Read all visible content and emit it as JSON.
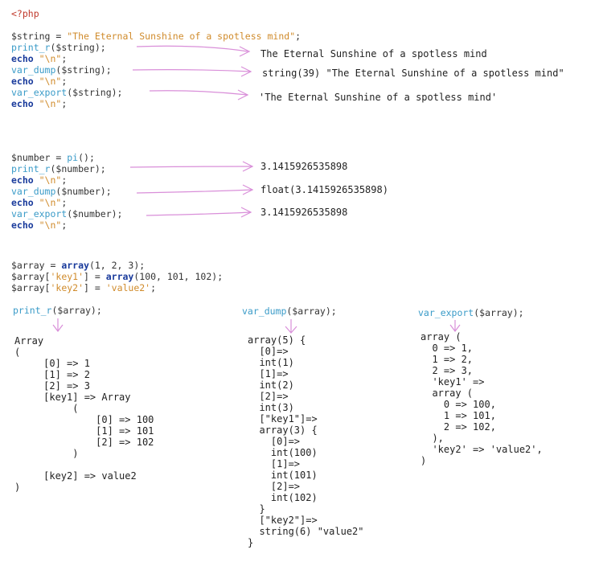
{
  "section1": {
    "open_tag": "<?php",
    "l1_var": "$string = ",
    "l1_str": "\"The Eternal Sunshine of a spotless mind\"",
    "l1_end": ";",
    "l2_fn": "print_r",
    "l2_rest": "($string);",
    "l3_kw": "echo",
    "l3_str": " \"\\n\"",
    "l3_end": ";",
    "l4_fn": "var_dump",
    "l4_rest": "($string);",
    "l5_kw": "echo",
    "l5_str": " \"\\n\"",
    "l5_end": ";",
    "l6_fn": "var_export",
    "l6_rest": "($string);",
    "l7_kw": "echo",
    "l7_str": " \"\\n\"",
    "l7_end": ";",
    "out1": "The Eternal Sunshine of a spotless mind",
    "out2": "string(39) \"The Eternal Sunshine of a spotless mind\"",
    "out3": "'The Eternal Sunshine of a spotless mind'"
  },
  "section2": {
    "l1_var": "$number = ",
    "l1_fn": "pi",
    "l1_end": "();",
    "l2_fn": "print_r",
    "l2_rest": "($number);",
    "l3_kw": "echo",
    "l3_str": " \"\\n\"",
    "l3_end": ";",
    "l4_fn": "var_dump",
    "l4_rest": "($number);",
    "l5_kw": "echo",
    "l5_str": " \"\\n\"",
    "l5_end": ";",
    "l6_fn": "var_export",
    "l6_rest": "($number);",
    "l7_kw": "echo",
    "l7_str": " \"\\n\"",
    "l7_end": ";",
    "out1": "3.1415926535898",
    "out2": "float(3.1415926535898)",
    "out3": "3.1415926535898"
  },
  "section3": {
    "l1_var": "$array = ",
    "l1_kw": "array",
    "l1_rest": "(1, 2, 3);",
    "l2_var": "$array[",
    "l2_str": "'key1'",
    "l2_mid": "] = ",
    "l2_kw": "array",
    "l2_rest": "(100, 101, 102);",
    "l3_var": "$array[",
    "l3_str": "'key2'",
    "l3_mid": "] = ",
    "l3_str2": "'value2'",
    "l3_end": ";"
  },
  "columns": {
    "print_r_fn": "print_r",
    "print_r_rest": "($array);",
    "var_dump_fn": "var_dump",
    "var_dump_rest": "($array);",
    "var_export_fn": "var_export",
    "var_export_rest": "($array);"
  },
  "print_r_output": [
    "Array",
    "(",
    "     [0] => 1",
    "     [1] => 2",
    "     [2] => 3",
    "     [key1] => Array",
    "          (",
    "              [0] => 100",
    "              [1] => 101",
    "              [2] => 102",
    "          )",
    "",
    "     [key2] => value2",
    ")"
  ],
  "var_dump_output": [
    "array(5) {",
    "  [0]=>",
    "  int(1)",
    "  [1]=>",
    "  int(2)",
    "  [2]=>",
    "  int(3)",
    "  [\"key1\"]=>",
    "  array(3) {",
    "    [0]=>",
    "    int(100)",
    "    [1]=>",
    "    int(101)",
    "    [2]=>",
    "    int(102)",
    "  }",
    "  [\"key2\"]=>",
    "  string(6) \"value2\"",
    "}"
  ],
  "var_export_output": [
    "array (",
    "  0 => 1,",
    "  1 => 2,",
    "  2 => 3,",
    "  'key1' =>",
    "  array (",
    "    0 => 100,",
    "    1 => 101,",
    "    2 => 102,",
    "  ),",
    "  'key2' => 'value2',",
    ")"
  ]
}
